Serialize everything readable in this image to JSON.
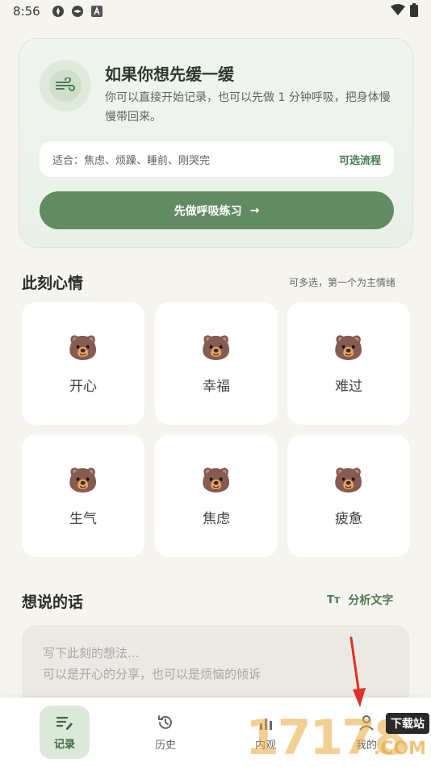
{
  "status_bar": {
    "time": "8:56"
  },
  "breath_card": {
    "title": "如果你想先缓一缓",
    "description": "你可以直接开始记录，也可以先做 1 分钟呼吸，把身体慢慢带回来。",
    "suitable": "适合：焦虑、烦躁、睡前、刚哭完",
    "optional_flow": "可选流程",
    "button_label": "先做呼吸练习",
    "button_arrow": "→"
  },
  "mood": {
    "title": "此刻心情",
    "hint": "可多选，第一个为主情绪",
    "items": [
      {
        "emoji": "🐻",
        "label": "开心"
      },
      {
        "emoji": "🐻",
        "label": "幸福"
      },
      {
        "emoji": "🐻",
        "label": "难过"
      },
      {
        "emoji": "🐻",
        "label": "生气"
      },
      {
        "emoji": "🐻",
        "label": "焦虑"
      },
      {
        "emoji": "🐻",
        "label": "疲惫"
      }
    ]
  },
  "words": {
    "title": "想说的话",
    "analyze_icon": "Tт",
    "analyze_label": "分析文字",
    "placeholder": "写下此刻的想法...\n可以是开心的分享，也可以是烦恼的倾诉"
  },
  "bottom_nav": {
    "items": [
      {
        "label": "记录",
        "icon": "edit-list-icon",
        "active": true
      },
      {
        "label": "历史",
        "icon": "history-icon",
        "active": false
      },
      {
        "label": "内观",
        "icon": "insight-icon",
        "active": false
      },
      {
        "label": "我的",
        "icon": "profile-icon",
        "active": false
      }
    ]
  },
  "watermark": {
    "number": "17178",
    "badge": "下载站",
    "domain": ".COM"
  },
  "colors": {
    "accent": "#628b63",
    "accent_text": "#4b7a4f",
    "background": "#f5f4ef"
  }
}
